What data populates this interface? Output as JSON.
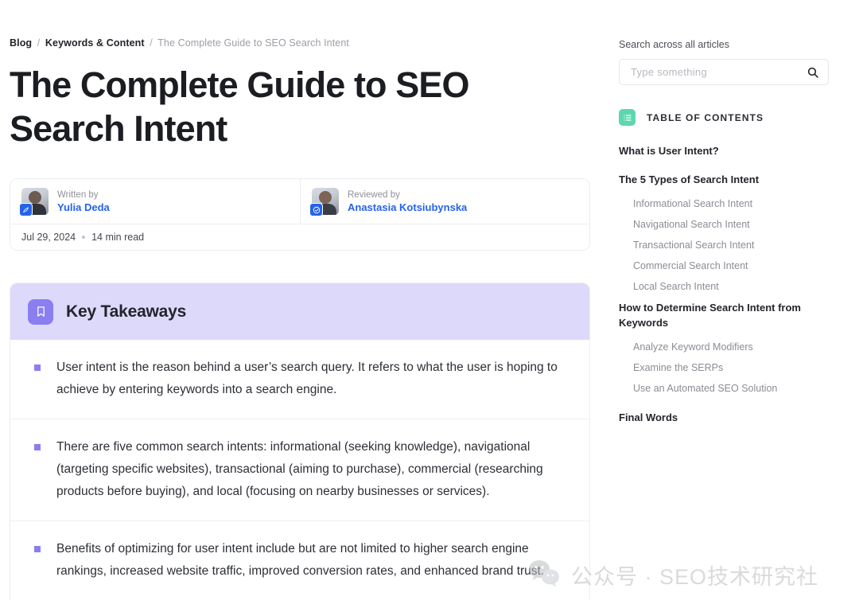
{
  "breadcrumb": {
    "items": [
      "Blog",
      "Keywords & Content",
      "The Complete Guide to SEO Search Intent"
    ],
    "separator": "/"
  },
  "article": {
    "title": "The Complete Guide to SEO Search Intent",
    "written_by_label": "Written by",
    "written_by_name": "Yulia Deda",
    "reviewed_by_label": "Reviewed by",
    "reviewed_by_name": "Anastasia Kotsiubynska",
    "date": "Jul 29, 2024",
    "read_time": "14 min read",
    "author_badge_icon": "pen-icon",
    "reviewer_badge_icon": "check-circle-icon"
  },
  "key_takeaways": {
    "heading": "Key Takeaways",
    "icon": "bookmark-icon",
    "header_bg": "#ddd9fb",
    "icon_bg": "#8b7ef0",
    "bullet_color": "#8b7ef0",
    "items": [
      "User intent is the reason behind a user’s search query. It refers to what the user is hoping to achieve by entering keywords into a search engine.",
      "There are five common search intents: informational (seeking knowledge), navigational (targeting specific websites), transactional (aiming to purchase), commercial (researching products before buying), and local (focusing on nearby businesses or services).",
      "Benefits of optimizing for user intent include but are not limited to higher search engine rankings, increased website traffic, improved conversion rates, and enhanced brand trust."
    ]
  },
  "sidebar": {
    "search": {
      "label": "Search across all articles",
      "placeholder": "Type something",
      "value": "",
      "icon": "search-icon"
    },
    "toc": {
      "header": "TABLE OF CONTENTS",
      "icon": "list-icon",
      "icon_bg": "#5fd6ae",
      "items": [
        {
          "label": "What is User Intent?",
          "level": 1,
          "gap_after": true
        },
        {
          "label": "The 5 Types of Search Intent",
          "level": 1
        },
        {
          "label": "Informational Search Intent",
          "level": 2
        },
        {
          "label": "Navigational Search Intent",
          "level": 2
        },
        {
          "label": "Transactional Search Intent",
          "level": 2
        },
        {
          "label": "Commercial Search Intent",
          "level": 2
        },
        {
          "label": "Local Search Intent",
          "level": 2
        },
        {
          "label": "How to Determine Search Intent from Keywords",
          "level": 1
        },
        {
          "label": "Analyze Keyword Modifiers",
          "level": 2
        },
        {
          "label": "Examine the SERPs",
          "level": 2
        },
        {
          "label": "Use an Automated SEO Solution",
          "level": 2,
          "gap_after": true
        },
        {
          "label": "Final Words",
          "level": 1
        }
      ]
    }
  },
  "watermark": {
    "text": "公众号 · SEO技术研究社",
    "icon": "wechat-icon"
  }
}
